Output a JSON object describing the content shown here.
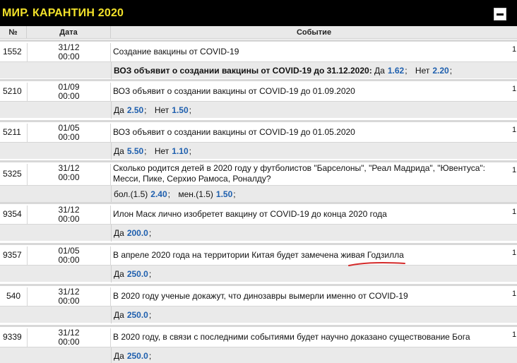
{
  "header": {
    "title": "МИР. КАРАНТИН 2020"
  },
  "columns": {
    "num": "№",
    "date": "Дата",
    "event": "Событие"
  },
  "rows": [
    {
      "id": "1552",
      "date": "31/12",
      "time": "00:00",
      "event": "Создание вакцины от COVID-19",
      "count": "1",
      "odds_text": "ВОЗ объявит о создании вакцины от COVID-19 до 31.12.2020:",
      "o1_label": "Да",
      "o1_value": "1.62",
      "o2_label": "Нет",
      "o2_value": "2.20"
    },
    {
      "id": "5210",
      "date": "01/09",
      "time": "00:00",
      "event": "ВОЗ объявит о создании вакцины от COVID-19 до 01.09.2020",
      "count": "1",
      "o1_label": "Да",
      "o1_value": "2.50",
      "o2_label": "Нет",
      "o2_value": "1.50"
    },
    {
      "id": "5211",
      "date": "01/05",
      "time": "00:00",
      "event": "ВОЗ объявит о создании вакцины от COVID-19 до 01.05.2020",
      "count": "1",
      "o1_label": "Да",
      "o1_value": "5.50",
      "o2_label": "Нет",
      "o2_value": "1.10"
    },
    {
      "id": "5325",
      "date": "31/12",
      "time": "00:00",
      "event": "Сколько родится детей в 2020 году у футболистов \"Барселоны\", \"Реал Мадрида\", \"Ювентуса\": Месси, Пике, Серхио Рамоса, Роналду?",
      "count": "1",
      "o1_label": "бол.(1.5)",
      "o1_value": "2.40",
      "o2_label": "мен.(1.5)",
      "o2_value": "1.50"
    },
    {
      "id": "9354",
      "date": "31/12",
      "time": "00:00",
      "event": "Илон Маск лично изобретет вакцину от COVID-19 до конца 2020 года",
      "count": "1",
      "o1_label": "Да",
      "o1_value": "200.0"
    },
    {
      "id": "9357",
      "date": "01/05",
      "time": "00:00",
      "event": "В апреле 2020 года на территории Китая будет замечена живая Годзилла",
      "count": "1",
      "o1_label": "Да",
      "o1_value": "250.0"
    },
    {
      "id": "540",
      "date": "31/12",
      "time": "00:00",
      "event": "В 2020 году ученые докажут, что динозавры вымерли именно от COVID-19",
      "count": "1",
      "o1_label": "Да",
      "o1_value": "250.0"
    },
    {
      "id": "9339",
      "date": "31/12",
      "time": "00:00",
      "event": "В 2020 году, в связи с последними событиями будет научно доказано существование Бога",
      "count": "1",
      "o1_label": "Да",
      "o1_value": "250.0"
    }
  ],
  "colors": {
    "header_bg": "#000000",
    "title": "#f2e12a",
    "odds_value": "#1e5fae",
    "annotation": "#d42a2a"
  },
  "icons": {
    "collapse": "minus-icon"
  }
}
